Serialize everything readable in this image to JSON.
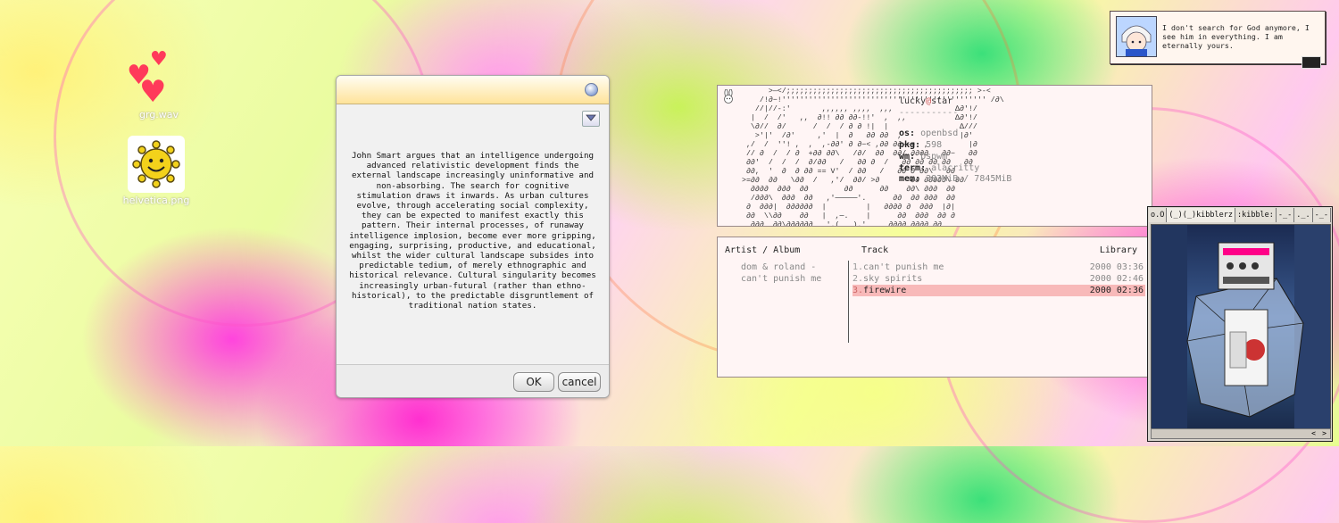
{
  "desktop": {
    "icons": [
      {
        "label": "grg.wav",
        "icon": "hearts-icon"
      },
      {
        "label": "helvetica.png",
        "icon": "sun-face-icon"
      }
    ]
  },
  "dialog": {
    "body": "John Smart argues that an intelligence undergoing advanced relativistic development finds the external landscape increasingly uninformative and non-absorbing. The search for cognitive stimulation draws it inwards. As urban cultures evolve, through accelerating social complexity, they can be expected to manifest exactly this pattern. Their internal processes, of runaway intelligence implosion, become ever more gripping, engaging, surprising, productive, and educational, whilst the wider cultural landscape subsides into predictable tedium, of merely ethnographic and historical relevance. Cultural singularity becomes increasingly urban-futural (rather than ethno-historical), to the predictable disgruntlement of traditional nation states.",
    "ok_label": "OK",
    "cancel_label": "cancel"
  },
  "neofetch": {
    "user": "lucky",
    "at": "@",
    "host": "star",
    "separator": "-----------",
    "os_key": "os:",
    "os_val": "openbsd",
    "pkg_key": "pkg:",
    "pkg_val": "598",
    "wm_key": "wm:",
    "wm_val": "bspwm",
    "term_key": "term:",
    "term_val": "alacritty",
    "mem_key": "mem:",
    "mem_val": "383MiB / 7845MiB",
    "ascii_art": "       >—</;;;;;;;;;;;;;;;;;;;;;;;;;;;;;;;;;;;;;;;;;; >-<\n     /!∂−!'''''''''''''''''''''''''''''''''''''''''''''' /∂\\\n    //|//-:'       ,,,,,, ,,,,  ,,,              ∆∂'!/\n   |  /  /'   ,,  ∂!! ∂∂ ∂∂-!!'  ,  ,,           ∆∂'!/\n   \\∂//  ∂/      /  /  / ∂ ∂ !|  |                ∆///\n    >'|'  /∂'     ,'  |  ∂   ∂∂ ∂∂  ,             |∂'\n  ,/  /  ''! ,  ,  ,-∂∂' ∂ ∂−< ,∂∂ ∂∂--+  ,         |∂\n  // ∂  /  / ∂  +∂∂ ∂∂\\   /∂/  ∂∂  ∂∂/ ∂∂∂∂   ∂∂−   ∂∂\n  ∂∂'  /  /  /  ∂/∂∂   /   ∂∂ ∂  /   ∂∂ ∂∂ ∂∂ ∂∂   ∂∂\n  ∂∂,  '  ∂  ∂ ∂∂ == V'  / ∂∂   /   ∂∂ ∂ ∂∂\\   ∂∂\n >=∂∂  ∂∂   \\∂∂  /   ,'/  ∂∂/ >∂       ∂∂ ∂∂∂∂∂\\ ∂∂\n   ∂∂∂∂  ∂∂∂  ∂∂        ∂∂      ∂∂    ∂∂\\ ∂∂∂  ∂∂\n   /∂∂∂\\  ∂∂∂  ∂∂   ,'─────'.      ∂∂  ∂∂ ∂∂∂  ∂∂\n  ∂  ∂∂∂|  ∂∂∂∂∂∂  |         |   ∂∂∂∂ ∂  ∂∂∂  |∂|\n  ∂∂  \\\\∂∂    ∂∂   |  ,─.    |      ∂∂  ∂∂∂  ∂∂ ∂\n   ∂∂∂  ∂∂\\∂∂∂∂∂∂   '.(   ).'     ∂∂∂∂ ∂∂∂∂ ∂∂\n    ∂∂∂   \\  ∂∂/ ∂∂∂   `─'     ∂∂∂∂ ∂∂ ∂∂∂ ∂∂\n     ∂∂∂∂   \\/ ∂∂∂∂∂  |   |  ∂∂∂ ∂∂∂∂∂ ∂∂\n        ─────  ∂ ∂∂  |   |   ∂─── ∂∂∂\n            ,∂'   |   |     ∂\n          /       |   |      \\"
  },
  "player": {
    "col_artist": "Artist / Album",
    "col_track": "Track",
    "col_library": "Library",
    "artist": "dom & roland -",
    "album": "can't punish me",
    "tracks": [
      {
        "num": "1.",
        "title": "can't punish me",
        "meta": "2000 03:36",
        "selected": false
      },
      {
        "num": "2.",
        "title": "sky spirits",
        "meta": "2000 02:46",
        "selected": false
      },
      {
        "num": "3.",
        "title": "firewire",
        "meta": "2000 02:36",
        "selected": true
      }
    ]
  },
  "notification": {
    "message": "I don't search for God anymore, I see him in everything. I am eternally yours."
  },
  "viewer": {
    "tabs": [
      {
        "label": "o.O"
      },
      {
        "label": "(_)(_)kibblerz"
      },
      {
        "label": ":kibble:"
      },
      {
        "label": "-_-"
      },
      {
        "label": "._."
      },
      {
        "label": "-_-"
      }
    ],
    "scroll_left": "<",
    "scroll_right": ">"
  },
  "colors": {
    "accent_selection": "#f8b9b9",
    "panel_bg": "#fff5f5",
    "dialog_titlebar": "#ffe39a"
  }
}
